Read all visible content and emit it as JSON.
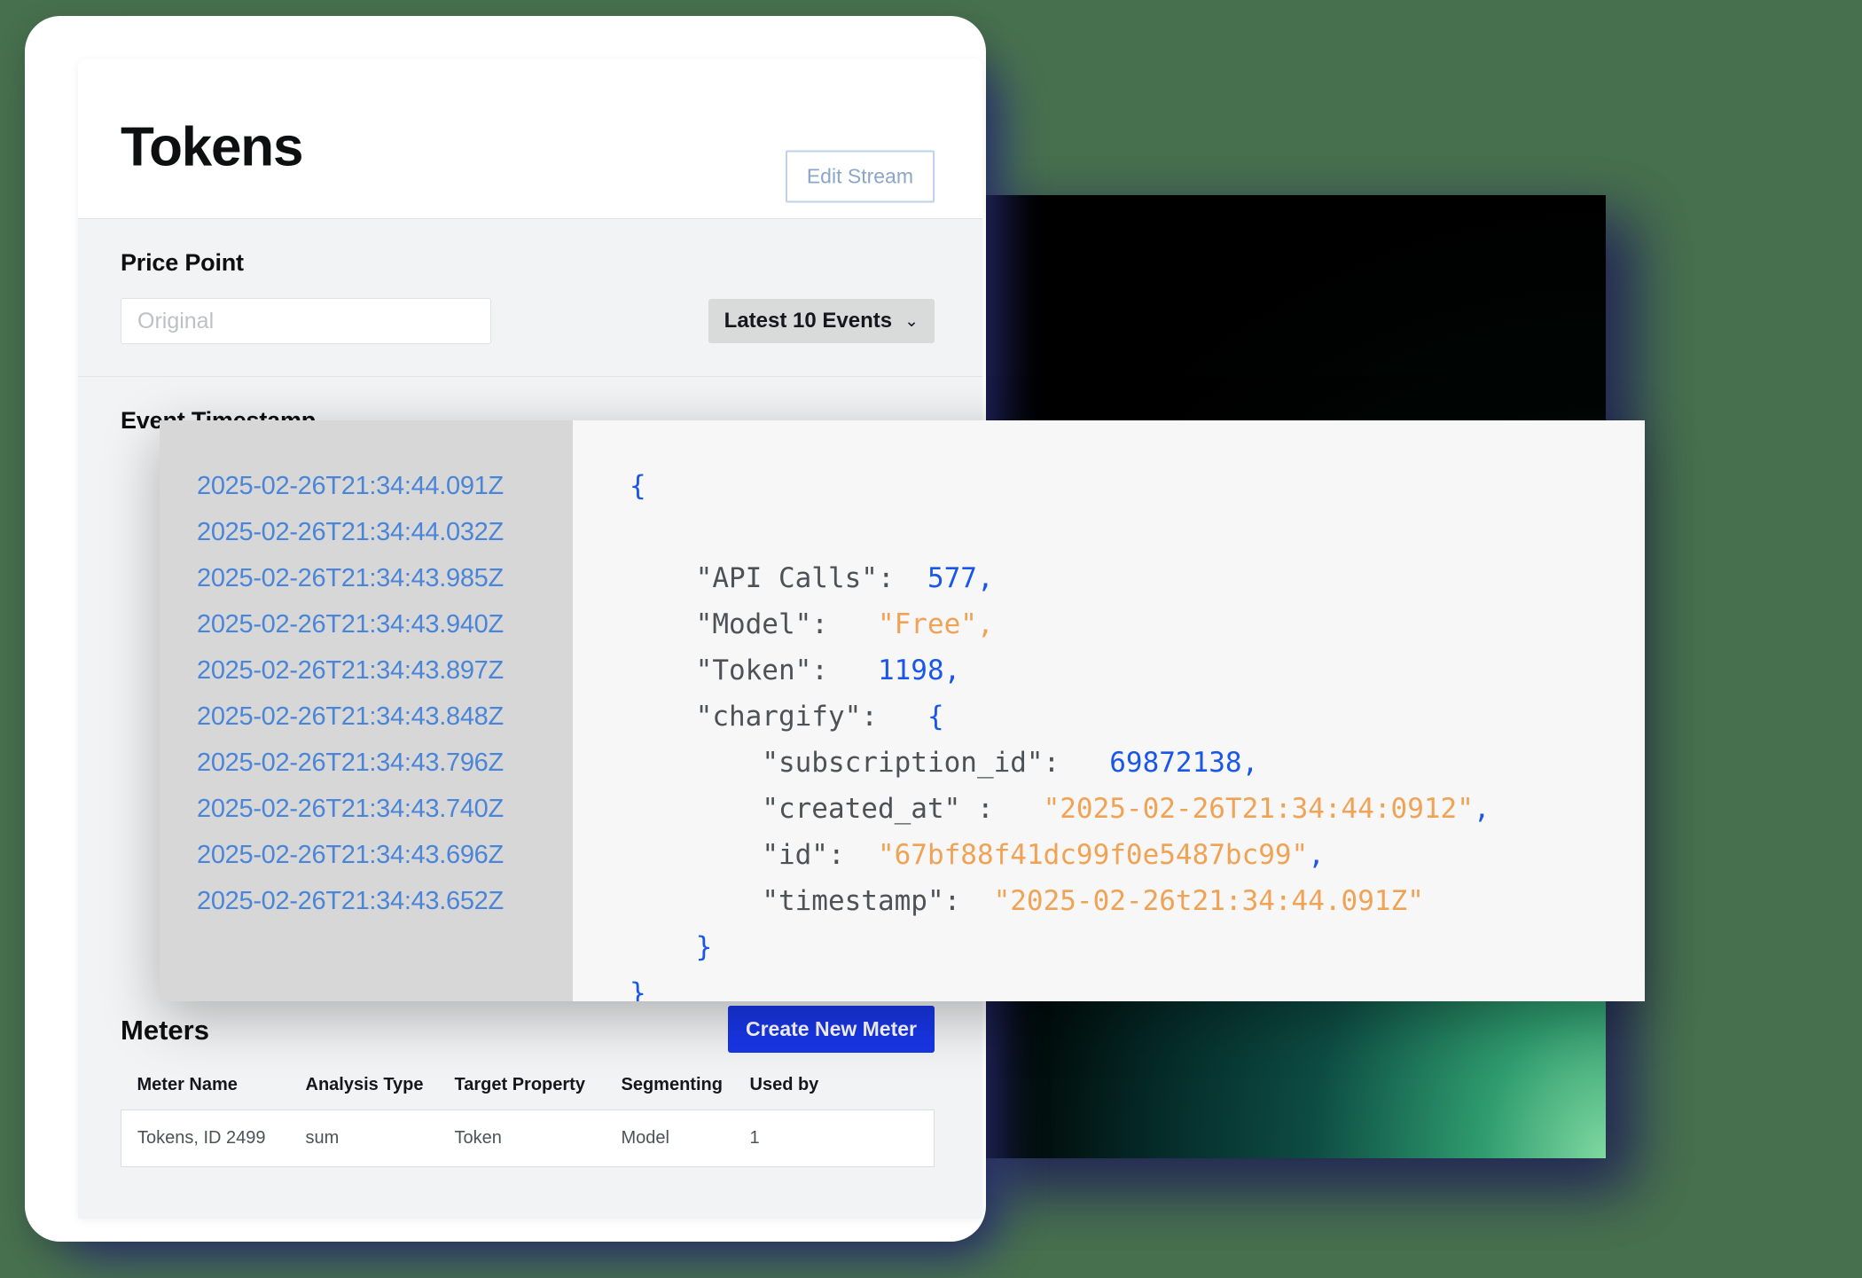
{
  "page": {
    "background_color": "#47704e",
    "accent_blue": "#1836e8",
    "link_blue": "#4a85d8"
  },
  "header": {
    "title": "Tokens",
    "edit_stream_label": "Edit Stream"
  },
  "price_point": {
    "label": "Price Point",
    "input_placeholder": "Original",
    "input_value": "",
    "dropdown_label": "Latest 10 Events",
    "dropdown_icon": "chevron-down-icon"
  },
  "event_timestamp": {
    "label": "Event Timestamp"
  },
  "data_inspector": {
    "timestamps": [
      "2025-02-26T21:34:44.091Z",
      "2025-02-26T21:34:44.032Z",
      "2025-02-26T21:34:43.985Z",
      "2025-02-26T21:34:43.940Z",
      "2025-02-26T21:34:43.897Z",
      "2025-02-26T21:34:43.848Z",
      "2025-02-26T21:34:43.796Z",
      "2025-02-26T21:34:43.740Z",
      "2025-02-26T21:34:43.696Z",
      "2025-02-26T21:34:43.652Z"
    ],
    "json_lines": {
      "l01_open": "{",
      "l02_key": "\"API Calls\":",
      "l02_val": "577,",
      "l03_key": "\"Model\":",
      "l03_val": "\"Free\",",
      "l04_key": "\"Token\":",
      "l04_val": "1198,",
      "l05_key": "\"chargify\":",
      "l05_val": "{",
      "l06_key": "\"subscription_id\":",
      "l06_val": "69872138,",
      "l07_key": "\"created_at\" :",
      "l07_val": "\"2025-02-26T21:34:44:0912\"",
      "l07_comma": ",",
      "l08_key": "\"id\":",
      "l08_val": "\"67bf88f41dc99f0e5487bc99\"",
      "l08_comma": ",",
      "l09_key": "\"timestamp\":",
      "l09_val": "\"2025-02-26t21:34:44.091Z\"",
      "l10_close": "}",
      "l11_close": "}"
    }
  },
  "meters": {
    "title": "Meters",
    "create_button_label": "Create New Meter",
    "columns": [
      "Meter Name",
      "Analysis Type",
      "Target Property",
      "Segmenting",
      "Used by"
    ],
    "rows": [
      {
        "meter_name": "Tokens, ID 2499",
        "analysis_type": "sum",
        "target_property": "Token",
        "segmenting": "Model",
        "used_by": "1"
      }
    ]
  }
}
